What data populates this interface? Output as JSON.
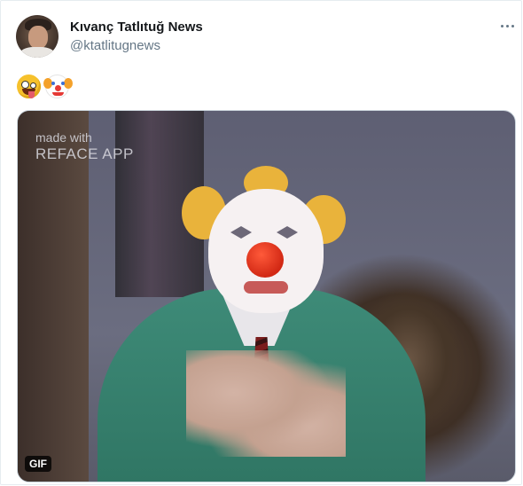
{
  "author": {
    "display_name": "Kıvanç Tatlıtuğ News",
    "handle": "@ktatlitugnews"
  },
  "tweet": {
    "emojis": [
      "zany-face",
      "clown-face"
    ]
  },
  "media": {
    "watermark_line1": "made with",
    "watermark_line2": "REFACE APP",
    "badge": "GIF"
  },
  "colors": {
    "name": "#14171a",
    "secondary": "#657786",
    "border": "#e6ecf0"
  }
}
